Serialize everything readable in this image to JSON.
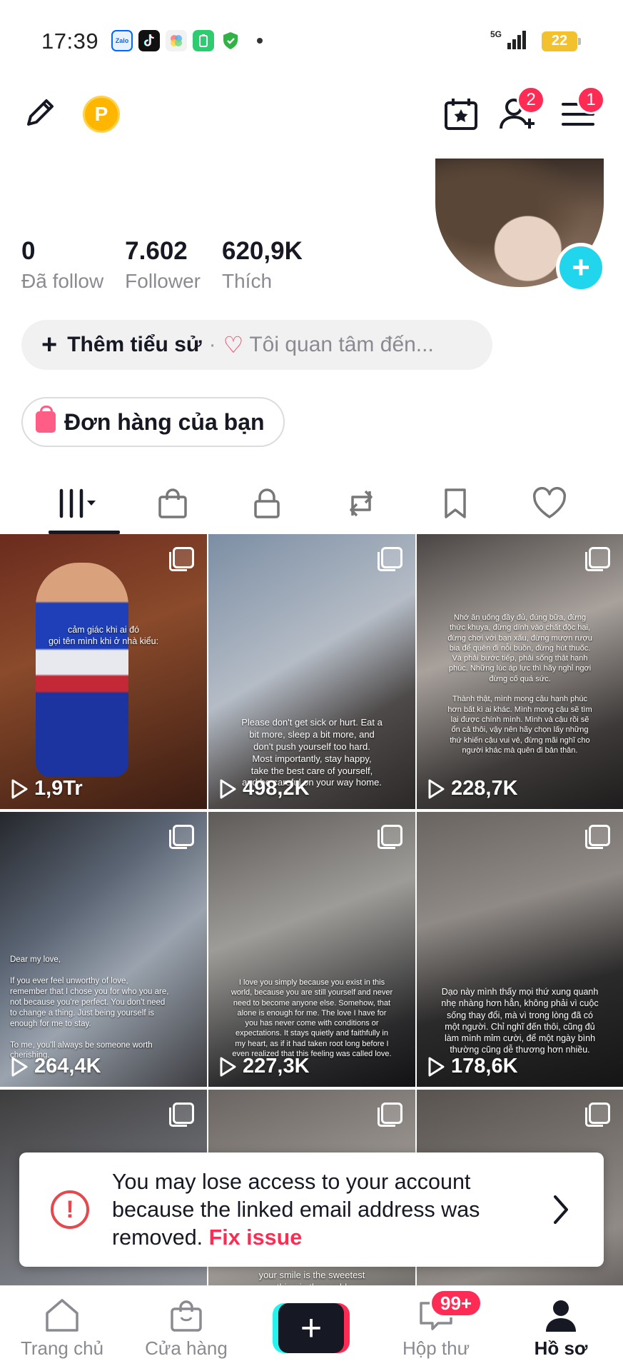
{
  "status_bar": {
    "time": "17:39",
    "network": "5G",
    "battery": "22",
    "notification_icons": [
      "zalo-icon",
      "tiktok-icon",
      "photos-icon",
      "battery-app-icon",
      "shield-icon"
    ]
  },
  "header": {
    "coin_label": "P",
    "friends_badge": "2",
    "menu_badge": "1"
  },
  "stats": [
    {
      "value": "0",
      "label": "Đã follow"
    },
    {
      "value": "7.602",
      "label": "Follower"
    },
    {
      "value": "620,9K",
      "label": "Thích"
    }
  ],
  "bio": {
    "add_label": "Thêm tiểu sử",
    "separator": "·",
    "interest_label": "Tôi quan tâm đến..."
  },
  "orders": {
    "label": "Đơn hàng của bạn"
  },
  "tabs": [
    "videos-tab",
    "shop-tab",
    "private-tab",
    "reposts-tab",
    "saved-tab",
    "liked-tab"
  ],
  "videos": [
    {
      "views": "1,9Tr",
      "caption": "cảm giác khi ai đó\ngọi tên mình khi ở nhà kiểu:"
    },
    {
      "views": "498,2K",
      "caption": "Please don't get sick or hurt. Eat a\nbit more, sleep a bit more, and\ndon't push yourself too hard.\nMost importantly, stay happy,\ntake the best care of yourself,\nand be careful on your way home."
    },
    {
      "views": "228,7K",
      "caption": "Nhớ ăn uống đầy đủ, đúng bữa, đừng\nthức khuya, đừng dính vào chất độc hại,\nđừng chơi với bạn xấu, đừng mượn rượu\nbia để quên đi nỗi buồn, đừng hút thuốc.\nVà phải bước tiếp, phải sống thật hạnh\nphúc. Những lúc áp lực thì hãy nghỉ ngơi\nđừng cố quá sức.\n\nThành thật, mình mong cậu hạnh phúc\nhơn bất kì ai khác. Mình mong cậu sẽ tìm\nlại được chính mình. Mình và cậu rồi sẽ\nổn cả thôi, vậy nên hãy chọn lấy những\nthứ khiến cậu vui vẻ, đừng mãi nghĩ cho\nngười khác mà quên đi bản thân."
    },
    {
      "views": "264,4K",
      "caption": "Dear my love,\n\nIf you ever feel unworthy of love,\nremember that I chose you for who you are,\nnot because you're perfect. You don't need\nto change a thing. Just being yourself is\nenough for me to stay.\n\nTo me, you'll always be someone worth\ncherishing."
    },
    {
      "views": "227,3K",
      "caption": "I love you simply because you exist in this\nworld, because you are still yourself and never\nneed to become anyone else. Somehow, that\nalone is enough for me. The love I have for\nyou has never come with conditions or\nexpectations. It stays quietly and faithfully in\nmy heart, as if it had taken root long before I\neven realized that this feeling was called love."
    },
    {
      "views": "178,6K",
      "caption": "Dạo này mình thấy mọi thứ xung quanh\nnhẹ nhàng hơn hẳn, không phải vì cuộc\nsống thay đổi, mà vì trong lòng đã có\nmột người. Chỉ nghĩ đến thôi, cũng đủ\nlàm mình mỉm cười, để một ngày bình\nthường cũng dễ thương hơn nhiều."
    },
    {
      "views": "",
      "caption": ""
    },
    {
      "views": "",
      "caption": "your smile is the sweetest\nthing in the world"
    },
    {
      "views": "",
      "caption": ""
    }
  ],
  "banner": {
    "message": "You may lose access to your account because the linked email address was removed.",
    "action": "Fix issue"
  },
  "bottom_nav": {
    "home": "Trang chủ",
    "shop": "Cửa hàng",
    "create": "+",
    "inbox": "Hộp thư",
    "inbox_badge": "99+",
    "profile": "Hồ sơ"
  },
  "colors": {
    "accent": "#fe2c55",
    "cyan": "#25f4ee",
    "text": "#161823",
    "muted": "#8a8b91"
  }
}
